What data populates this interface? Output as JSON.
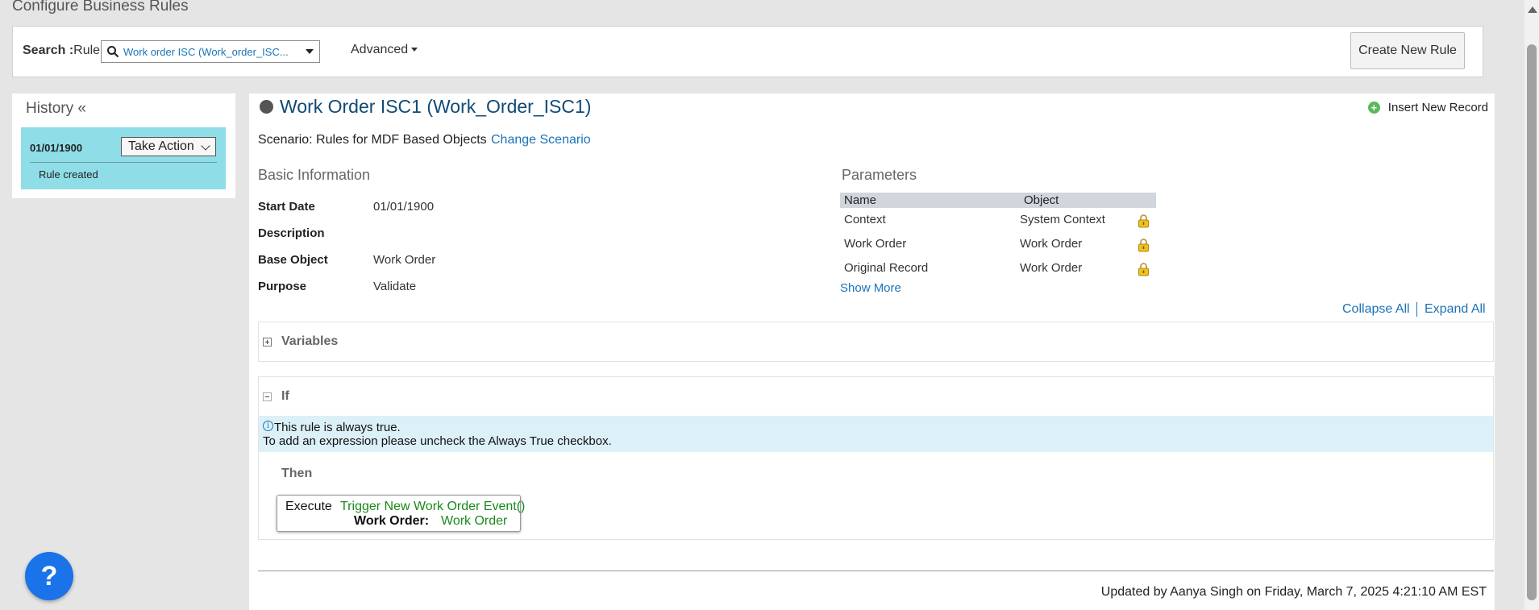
{
  "page": {
    "title": "Configure Business Rules"
  },
  "search": {
    "label_bold": "Search :",
    "label_type": "Rule",
    "value": "Work order ISC (Work_order_ISC...",
    "advanced_label": "Advanced",
    "create_button": "Create New Rule"
  },
  "history": {
    "title": "History «",
    "entries": [
      {
        "date": "01/01/1900",
        "action_label": "Take Action",
        "note": "Rule created"
      }
    ]
  },
  "rule": {
    "title": "Work Order ISC1 (Work_Order_ISC1)",
    "insert_record": "Insert New Record",
    "scenario": "Scenario: Rules for MDF Based Objects",
    "change_scenario": "Change Scenario",
    "basic_info": {
      "heading": "Basic Information",
      "fields": [
        {
          "label": "Start Date",
          "value": "01/01/1900"
        },
        {
          "label": "Description",
          "value": ""
        },
        {
          "label": "Base Object",
          "value": "Work Order"
        },
        {
          "label": "Purpose",
          "value": "Validate"
        }
      ]
    },
    "parameters": {
      "heading": "Parameters",
      "columns": [
        "Name",
        "Object"
      ],
      "rows": [
        {
          "name": "Context",
          "object": "System Context"
        },
        {
          "name": "Work Order",
          "object": "Work Order"
        },
        {
          "name": "Original Record",
          "object": "Work Order"
        }
      ],
      "show_more": "Show More"
    },
    "collapse_all": "Collapse All",
    "expand_all": "Expand All",
    "variables_title": "Variables",
    "if_title": "If",
    "info_line1": "This rule is always true.",
    "info_line2": "To add an expression please uncheck the Always True checkbox.",
    "then_title": "Then",
    "execute": {
      "label": "Execute",
      "function": "Trigger New Work Order Event()",
      "param_label": "Work Order:",
      "param_value": "Work Order"
    },
    "updated": "Updated by Aanya Singh on Friday, March 7, 2025 4:21:10 AM EST"
  },
  "help": {
    "symbol": "?"
  },
  "colors": {
    "accent_link": "#1a74b8",
    "history_card": "#8fdde7",
    "function_green": "#1a8a1a",
    "help_blue": "#1a73e8"
  }
}
